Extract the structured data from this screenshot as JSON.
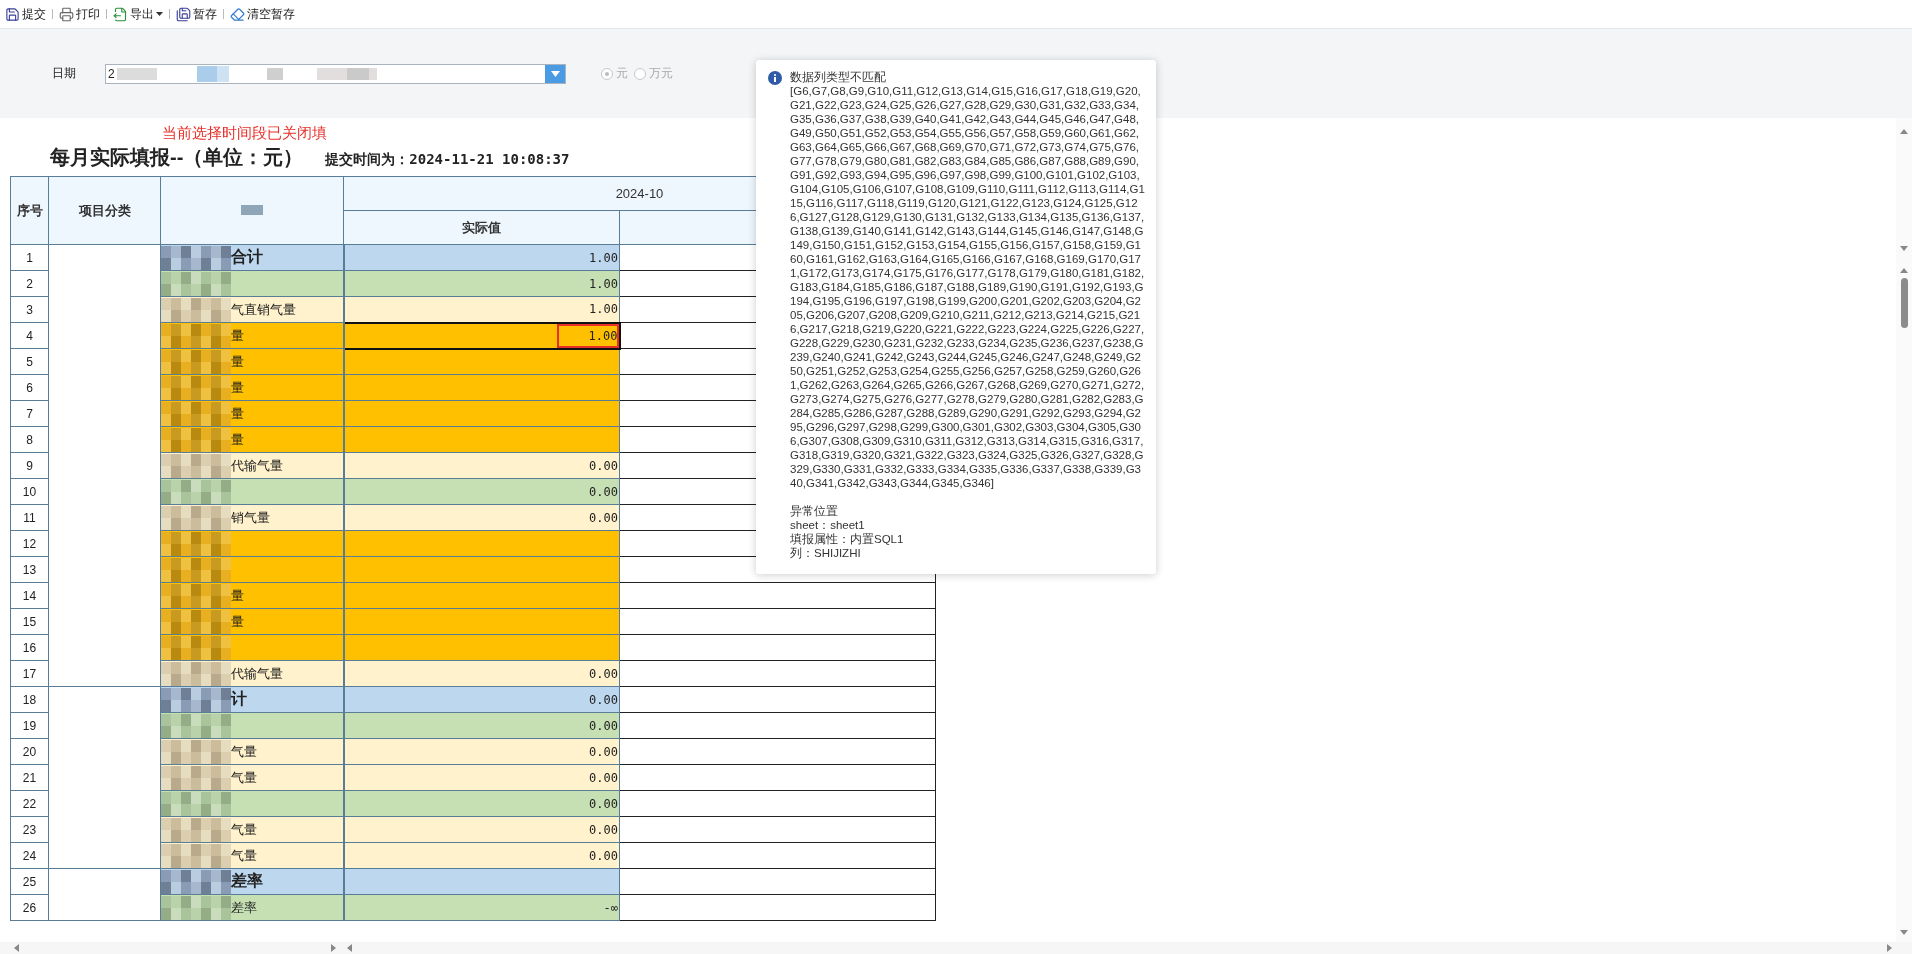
{
  "toolbar": [
    {
      "kind": "submit",
      "label": "提交"
    },
    {
      "kind": "print",
      "label": "打印"
    },
    {
      "kind": "export",
      "label": "导出",
      "caret": true
    },
    {
      "kind": "save",
      "label": "暂存"
    },
    {
      "kind": "clear",
      "label": "清空暂存"
    }
  ],
  "filter": {
    "date_label": "日期",
    "date_value": "2",
    "units_disabled": true,
    "units": [
      {
        "label": "元",
        "selected": true
      },
      {
        "label": "万元",
        "selected": false
      }
    ]
  },
  "notice": "当前选择时间段已关闭填",
  "title": "每月实际填报--（单位：元）",
  "submit_time": "提交时间为：2024-11-21 10:08:37",
  "table": {
    "columns": [
      "序号",
      "项目分类"
    ],
    "period": "2024-10",
    "value_column": "实际值",
    "groups": [
      {
        "rows": [
          {
            "no": "1",
            "kind": "total",
            "label": "合计",
            "value": "1.00",
            "selected": false,
            "flagged": false
          },
          {
            "no": "2",
            "kind": "sub",
            "label": "",
            "value": "1.00",
            "selected": false,
            "flagged": false
          },
          {
            "no": "3",
            "kind": "item",
            "label": "气直销气量",
            "value": "1.00",
            "selected": false,
            "flagged": false
          },
          {
            "no": "4",
            "kind": "input",
            "label": "量",
            "value": "1.00",
            "selected": true,
            "flagged": true
          },
          {
            "no": "5",
            "kind": "input",
            "label": "量",
            "value": "",
            "selected": false,
            "flagged": false
          },
          {
            "no": "6",
            "kind": "input",
            "label": "量",
            "value": "",
            "selected": false,
            "flagged": false
          },
          {
            "no": "7",
            "kind": "input",
            "label": "量",
            "value": "",
            "selected": false,
            "flagged": false
          },
          {
            "no": "8",
            "kind": "input",
            "label": "量",
            "value": "",
            "selected": false,
            "flagged": false
          },
          {
            "no": "9",
            "kind": "item",
            "label": "代输气量",
            "value": "0.00",
            "selected": false,
            "flagged": false
          },
          {
            "no": "10",
            "kind": "sub",
            "label": "",
            "value": "0.00",
            "selected": false,
            "flagged": false
          },
          {
            "no": "11",
            "kind": "item",
            "label": "销气量",
            "value": "0.00",
            "selected": false,
            "flagged": false
          },
          {
            "no": "12",
            "kind": "input",
            "label": "",
            "value": "",
            "selected": false,
            "flagged": false
          },
          {
            "no": "13",
            "kind": "input",
            "label": "",
            "value": "",
            "selected": false,
            "flagged": false
          },
          {
            "no": "14",
            "kind": "input",
            "label": "量",
            "value": "",
            "selected": false,
            "flagged": false
          },
          {
            "no": "15",
            "kind": "input",
            "label": "量",
            "value": "",
            "selected": false,
            "flagged": false
          },
          {
            "no": "16",
            "kind": "input",
            "label": "",
            "value": "",
            "selected": false,
            "flagged": false
          },
          {
            "no": "17",
            "kind": "item",
            "label": "代输气量",
            "value": "0.00",
            "selected": false,
            "flagged": false
          }
        ]
      },
      {
        "rows": [
          {
            "no": "18",
            "kind": "total",
            "label": "计",
            "value": "0.00",
            "selected": false,
            "flagged": false
          },
          {
            "no": "19",
            "kind": "sub",
            "label": "",
            "value": "0.00",
            "selected": false,
            "flagged": false
          },
          {
            "no": "20",
            "kind": "item",
            "label": "气量",
            "value": "0.00",
            "selected": false,
            "flagged": false
          },
          {
            "no": "21",
            "kind": "item",
            "label": "气量",
            "value": "0.00",
            "selected": false,
            "flagged": false
          },
          {
            "no": "22",
            "kind": "sub",
            "label": "",
            "value": "0.00",
            "selected": false,
            "flagged": false
          },
          {
            "no": "23",
            "kind": "item",
            "label": "气量",
            "value": "0.00",
            "selected": false,
            "flagged": false
          },
          {
            "no": "24",
            "kind": "item",
            "label": "气量",
            "value": "0.00",
            "selected": false,
            "flagged": false
          }
        ]
      },
      {
        "rows": [
          {
            "no": "25",
            "kind": "total",
            "label": "差率",
            "value": "",
            "selected": false,
            "flagged": false
          },
          {
            "no": "26",
            "kind": "sub",
            "label": "差率",
            "value": "-∞",
            "selected": false,
            "flagged": false
          }
        ]
      }
    ]
  },
  "tooltip": {
    "title": "数据列类型不匹配",
    "details": "[G6,G7,G8,G9,G10,G11,G12,G13,G14,G15,G16,G17,G18,G19,G20,G21,G22,G23,G24,G25,G26,G27,G28,G29,G30,G31,G32,G33,G34,G35,G36,G37,G38,G39,G40,G41,G42,G43,G44,G45,G46,G47,G48,G49,G50,G51,G52,G53,G54,G55,G56,G57,G58,G59,G60,G61,G62,G63,G64,G65,G66,G67,G68,G69,G70,G71,G72,G73,G74,G75,G76,G77,G78,G79,G80,G81,G82,G83,G84,G85,G86,G87,G88,G89,G90,G91,G92,G93,G94,G95,G96,G97,G98,G99,G100,G101,G102,G103,G104,G105,G106,G107,G108,G109,G110,G111,G112,G113,G114,G115,G116,G117,G118,G119,G120,G121,G122,G123,G124,G125,G126,G127,G128,G129,G130,G131,G132,G133,G134,G135,G136,G137,G138,G139,G140,G141,G142,G143,G144,G145,G146,G147,G148,G149,G150,G151,G152,G153,G154,G155,G156,G157,G158,G159,G160,G161,G162,G163,G164,G165,G166,G167,G168,G169,G170,G171,G172,G173,G174,G175,G176,G177,G178,G179,G180,G181,G182,G183,G184,G185,G186,G187,G188,G189,G190,G191,G192,G193,G194,G195,G196,G197,G198,G199,G200,G201,G202,G203,G204,G205,G206,G207,G208,G209,G210,G211,G212,G213,G214,G215,G216,G217,G218,G219,G220,G221,G222,G223,G224,G225,G226,G227,G228,G229,G230,G231,G232,G233,G234,G235,G236,G237,G238,G239,G240,G241,G242,G243,G244,G245,G246,G247,G248,G249,G250,G251,G252,G253,G254,G255,G256,G257,G258,G259,G260,G261,G262,G263,G264,G265,G266,G267,G268,G269,G270,G271,G272,G273,G274,G275,G276,G277,G278,G279,G280,G281,G282,G283,G284,G285,G286,G287,G288,G289,G290,G291,G292,G293,G294,G295,G296,G297,G298,G299,G300,G301,G302,G303,G304,G305,G306,G307,G308,G309,G310,G311,G312,G313,G314,G315,G316,G317,G318,G319,G320,G321,G322,G323,G324,G325,G326,G327,G328,G329,G330,G331,G332,G333,G334,G335,G336,G337,G338,G339,G340,G341,G342,G343,G344,G345,G346]",
    "location_heading": "异常位置",
    "location": [
      "sheet：sheet1",
      "填报属性：内置SQL1",
      "列：SHIJIZHI"
    ]
  }
}
